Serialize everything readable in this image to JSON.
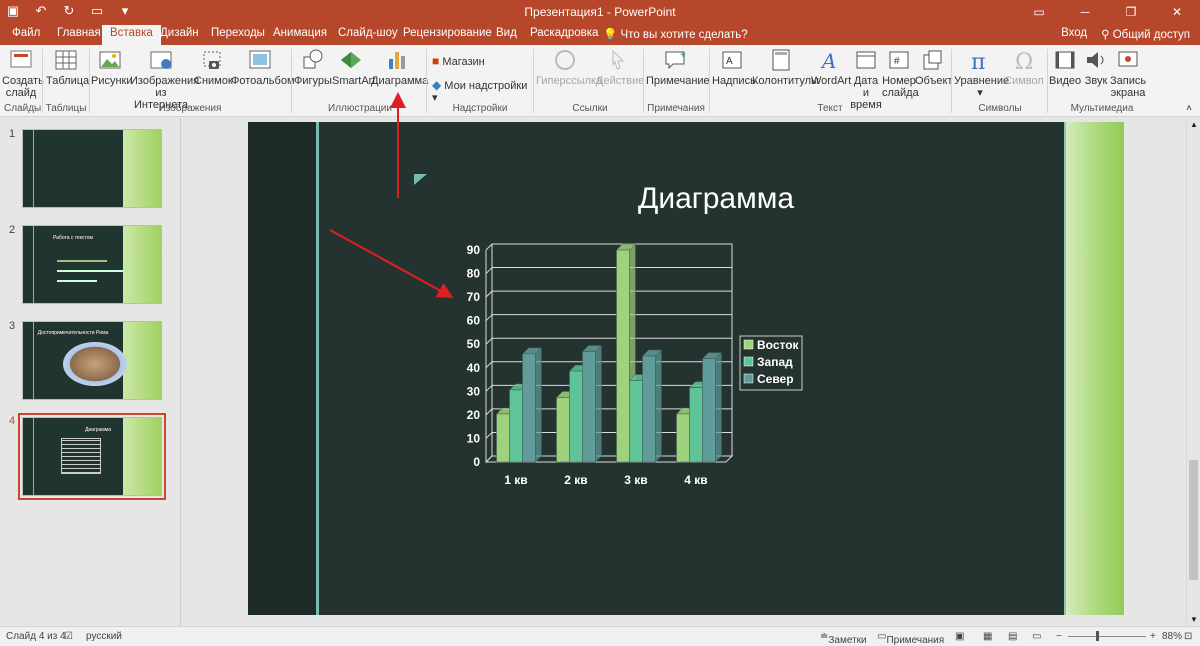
{
  "window": {
    "title": "Презентация1 - PowerPoint"
  },
  "tabs": [
    "Файл",
    "Главная",
    "Вставка",
    "Дизайн",
    "Переходы",
    "Анимация",
    "Слайд-шоу",
    "Рецензирование",
    "Вид",
    "Раскадровка"
  ],
  "tell_me": "Что вы хотите сделать?",
  "sign_in": "Вход",
  "share": "Общий доступ",
  "ribbon": {
    "new_slide": "Создать слайд",
    "table": "Таблица",
    "pictures": "Рисунки",
    "online_pictures": "Изображения из Интернета",
    "screenshot": "Снимок",
    "photo_album": "Фотоальбом",
    "shapes": "Фигуры",
    "smartart": "SmartArt",
    "chart": "Диаграмма",
    "store": "Магазин",
    "my_addins": "Мои надстройки",
    "hyperlink": "Гиперссылка",
    "action": "Действие",
    "comment": "Примечание",
    "textbox": "Надпись",
    "header_footer": "Колонтитулы",
    "wordart": "WordArt",
    "date_time": "Дата и время",
    "slide_number": "Номер слайда",
    "object": "Объект",
    "equation": "Уравнение",
    "symbol": "Символ",
    "video": "Видео",
    "audio": "Звук",
    "screen_recording": "Запись экрана",
    "groups": {
      "slides": "Слайды",
      "tables": "Таблицы",
      "images": "Изображения",
      "illustrations": "Иллюстрации",
      "addins": "Надстройки",
      "links": "Ссылки",
      "comments": "Примечания",
      "text": "Текст",
      "symbols": "Символы",
      "media": "Мультимедиа"
    }
  },
  "thumbnails": {
    "numbers": [
      "1",
      "2",
      "3",
      "4"
    ],
    "slide2_title": "Работа с текстом",
    "slide3_title": "Достопримечательности Рима",
    "slide4_title": "Диаграмма"
  },
  "slide": {
    "title": "Диаграмма"
  },
  "chart_data": {
    "type": "bar",
    "categories": [
      "1 кв",
      "2 кв",
      "3 кв",
      "4 кв"
    ],
    "series": [
      {
        "name": "Восток",
        "values": [
          20.4,
          27.4,
          90,
          20.4
        ]
      },
      {
        "name": "Запад",
        "values": [
          30.6,
          38.6,
          34.6,
          31.6
        ]
      },
      {
        "name": "Север",
        "values": [
          45.9,
          46.9,
          45,
          43.9
        ]
      }
    ],
    "ylim": [
      0,
      90
    ],
    "yticks": [
      "0",
      "10",
      "20",
      "30",
      "40",
      "50",
      "60",
      "70",
      "80",
      "90"
    ],
    "colors": [
      "#9fd27d",
      "#5fc598",
      "#5f9c9a"
    ],
    "legend": "right",
    "grid": true
  },
  "status": {
    "slide_counter": "Слайд 4 из 4",
    "language": "русский",
    "notes": "Заметки",
    "comments": "Примечания",
    "zoom": "88%"
  }
}
